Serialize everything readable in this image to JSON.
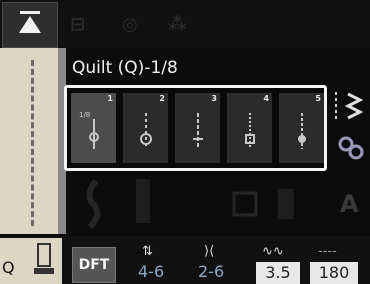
{
  "title": "Quilt (Q)-1/8",
  "stitches": [
    {
      "number": "1",
      "label": "1/8"
    },
    {
      "number": "2",
      "label": ""
    },
    {
      "number": "3",
      "label": ""
    },
    {
      "number": "4",
      "label": ""
    },
    {
      "number": "5",
      "label": ""
    }
  ],
  "selected_stitch": 1,
  "bottom": {
    "left_label": "Q",
    "dft_label": "DFT",
    "stitch_length_range": "4-6",
    "stitch_width_range": "2-6",
    "length_value": "3.5",
    "width_value": "180"
  },
  "colors": {
    "frame": "#f4f4f4",
    "panel": "#dcd6c4",
    "value_blue": "#8ea8c8"
  },
  "icons": [
    "up-arrow-icon",
    "stitch-length-icon",
    "stitch-width-icon",
    "zigzag-icon",
    "mirror-icon"
  ]
}
